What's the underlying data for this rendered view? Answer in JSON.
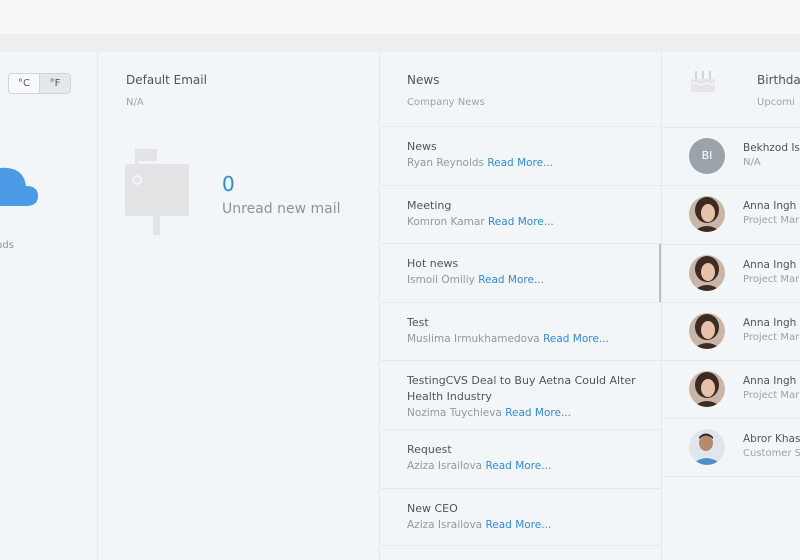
{
  "weather": {
    "unit_celsius": "°C",
    "unit_fahrenheit": "°F",
    "description": "uds",
    "icon": "cloud-icon"
  },
  "email": {
    "title": "Default Email",
    "address": "N/A",
    "unread_count": "0",
    "unread_label": "Unread new mail",
    "icon": "mailbox-icon"
  },
  "news": {
    "title": "News",
    "subtitle": "Company News",
    "read_more_label": "Read More...",
    "items": [
      {
        "title": "News",
        "author": "Ryan Reynolds",
        "read_more": "Read More..."
      },
      {
        "title": "Meeting",
        "author": "Komron Kamar",
        "read_more": "Read More..."
      },
      {
        "title": "Hot news",
        "author": "Ismoil Omiliy",
        "read_more": "Read More..."
      },
      {
        "title": "Test",
        "author": "Muslima Irmukhamedova",
        "read_more": "Read More..."
      },
      {
        "title": "TestingCVS Deal to Buy Aetna Could Alter Health Industry",
        "author": "Nozima Tuychieva",
        "read_more": "Read More..."
      },
      {
        "title": "Request",
        "author": "Aziza Israilova",
        "read_more": "Read More..."
      },
      {
        "title": "New CEO",
        "author": "Aziza Israilova",
        "read_more": "Read More..."
      }
    ]
  },
  "birthdays": {
    "title": "Birthda",
    "subtitle": "Upcomi",
    "icon": "cake-icon",
    "items": [
      {
        "initials": "BI",
        "name": "Bekhzod Is",
        "role": "N/A"
      },
      {
        "initials": "",
        "name": "Anna Ingh",
        "role": "Project Mar"
      },
      {
        "initials": "",
        "name": "Anna Ingh",
        "role": "Project Mar"
      },
      {
        "initials": "",
        "name": "Anna Ingh",
        "role": "Project Mar"
      },
      {
        "initials": "",
        "name": "Anna Ingh",
        "role": "Project Mar"
      },
      {
        "initials": "",
        "name": "Abror Khas",
        "role": "Customer S"
      }
    ]
  },
  "colors": {
    "accent": "#2f8ad3",
    "background": "#f3f6f8",
    "border": "#e6e9ec"
  }
}
